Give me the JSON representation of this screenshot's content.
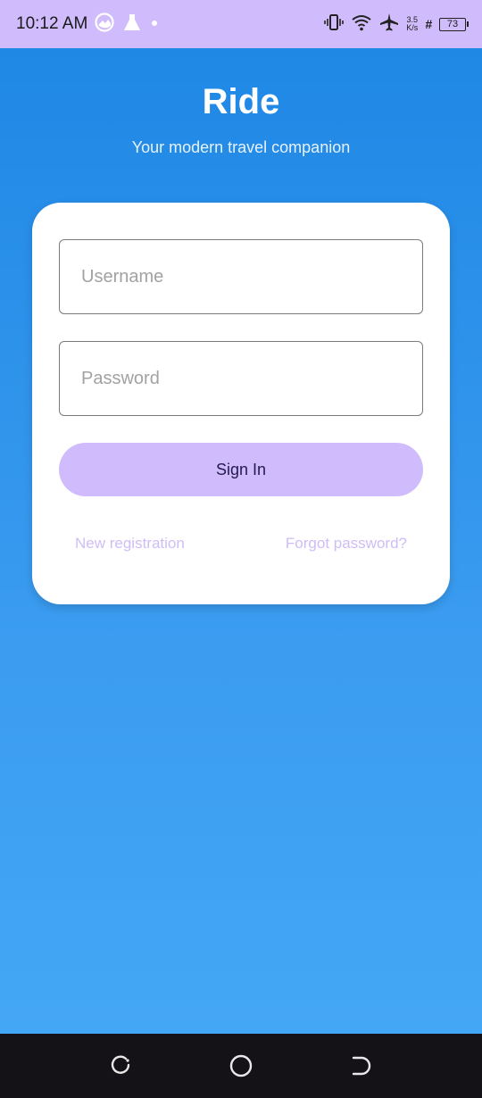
{
  "status_bar": {
    "time": "10:12 AM",
    "speed_value": "3.5",
    "speed_unit": "K/s",
    "network": "#",
    "battery": "73",
    "background_color": "#d0bcfc",
    "icons": [
      "gallery-icon",
      "flask-icon",
      "dot-icon",
      "vibrate-icon",
      "wifi-icon",
      "airplane-icon",
      "battery-icon"
    ]
  },
  "app": {
    "title": "Ride",
    "subtitle": "Your modern travel companion"
  },
  "login": {
    "username_placeholder": "Username",
    "username_value": "",
    "password_placeholder": "Password",
    "password_value": "",
    "signin_label": "Sign In",
    "register_link": "New registration",
    "forgot_link": "Forgot password?"
  },
  "colors": {
    "accent": "#d0bcfc",
    "gradient_top": "#1f88e5",
    "gradient_bottom": "#44a7f5",
    "link": "#cfbdf7"
  },
  "nav_bar": {
    "icons": [
      "recent-apps-icon",
      "home-icon",
      "back-icon"
    ]
  }
}
